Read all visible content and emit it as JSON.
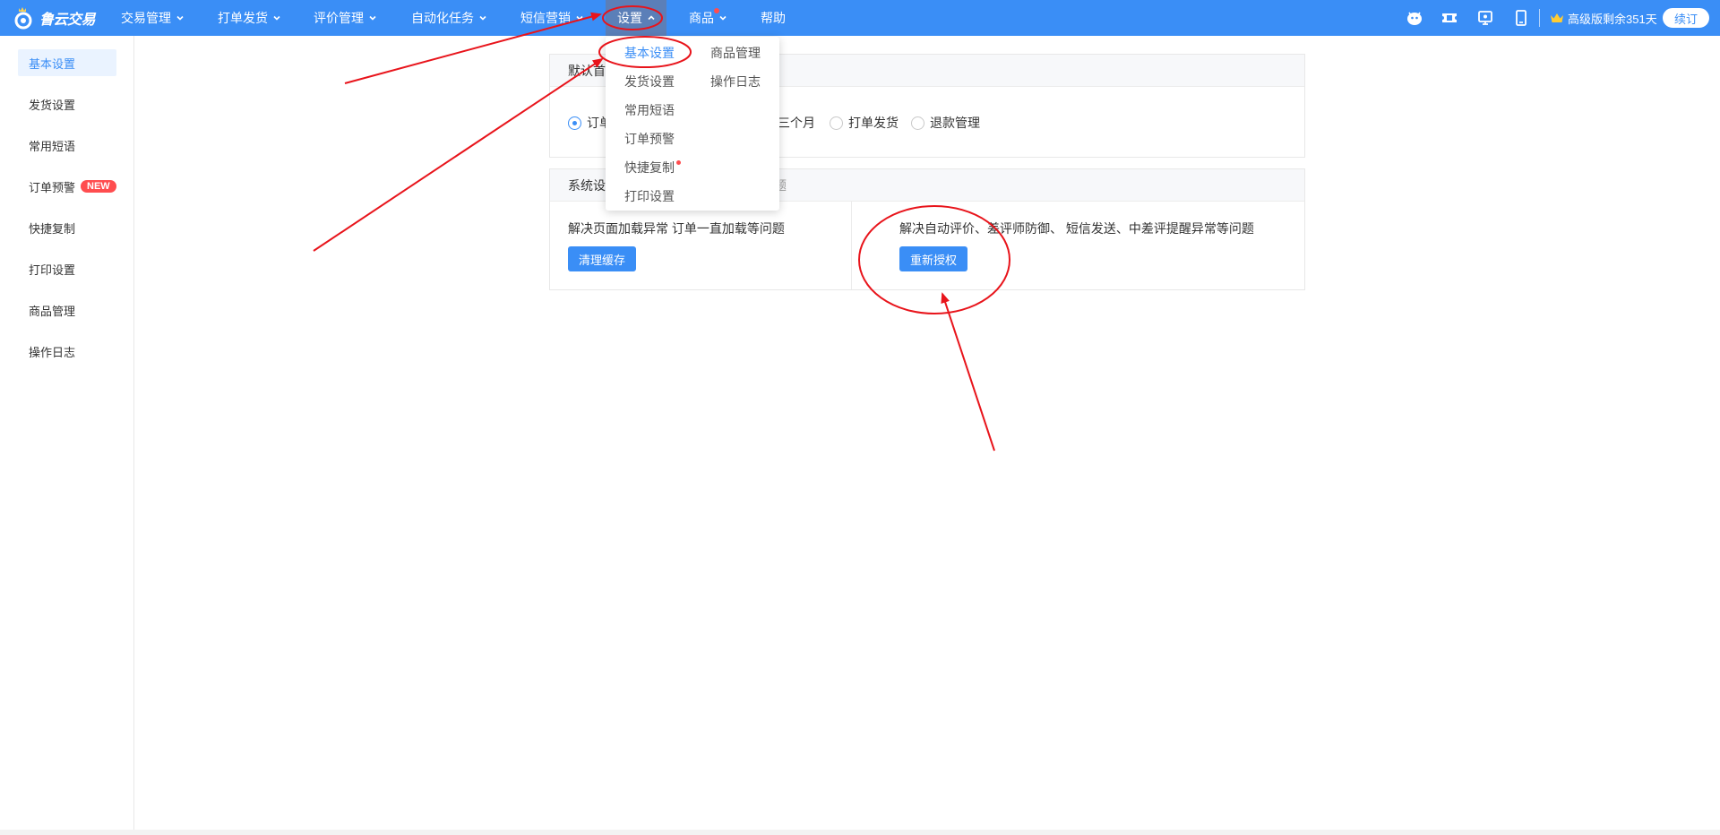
{
  "brand": {
    "name": "鲁云交易"
  },
  "nav": [
    {
      "label": "交易管理",
      "chevron": "down"
    },
    {
      "label": "打单发货",
      "chevron": "down"
    },
    {
      "label": "评价管理",
      "chevron": "down"
    },
    {
      "label": "自动化任务",
      "chevron": "down"
    },
    {
      "label": "短信营销",
      "chevron": "down"
    },
    {
      "label": "设置",
      "chevron": "up",
      "active": true
    },
    {
      "label": "商品",
      "chevron": "down",
      "dot": true
    },
    {
      "label": "帮助"
    }
  ],
  "top_icons": [
    "chat-bot-icon",
    "ticket-icon",
    "monitor-icon",
    "mobile-icon"
  ],
  "vip": {
    "icon": "crown-icon",
    "text": "高级版剩余351天",
    "renew_label": "续订"
  },
  "sidebar": {
    "items": [
      {
        "label": "基本设置",
        "active": true
      },
      {
        "label": "发货设置"
      },
      {
        "label": "常用短语"
      },
      {
        "label": "订单预警",
        "badge": "NEW"
      },
      {
        "label": "快捷复制"
      },
      {
        "label": "打印设置"
      },
      {
        "label": "商品管理"
      },
      {
        "label": "操作日志"
      }
    ]
  },
  "home_panel": {
    "header_visible": "默认首",
    "radios": [
      {
        "label": "订单",
        "checked": true
      },
      {
        "label": "三个月",
        "checked": false,
        "partial": true
      },
      {
        "label": "打单发货",
        "checked": false
      },
      {
        "label": "退款管理",
        "checked": false
      }
    ]
  },
  "system_panel": {
    "header_visible": "系统设",
    "header_tail": "题",
    "left": {
      "desc": "解决页面加载异常 订单一直加载等问题",
      "button": "清理缓存"
    },
    "right": {
      "desc": "解决自动评价、差评师防御、 短信发送、中差评提醒异常等问题",
      "button": "重新授权"
    }
  },
  "dropdown": {
    "items": [
      {
        "label": "基本设置",
        "active": true
      },
      {
        "label": "商品管理"
      },
      {
        "label": "发货设置"
      },
      {
        "label": "操作日志"
      },
      {
        "label": "常用短语"
      },
      {
        "label": "订单预警"
      },
      {
        "label": "快捷复制",
        "dot": true
      },
      {
        "label": "打印设置"
      }
    ]
  },
  "colors": {
    "primary": "#3a8ef6",
    "annotation": "#e8141b",
    "badge": "#ff4d4f"
  }
}
